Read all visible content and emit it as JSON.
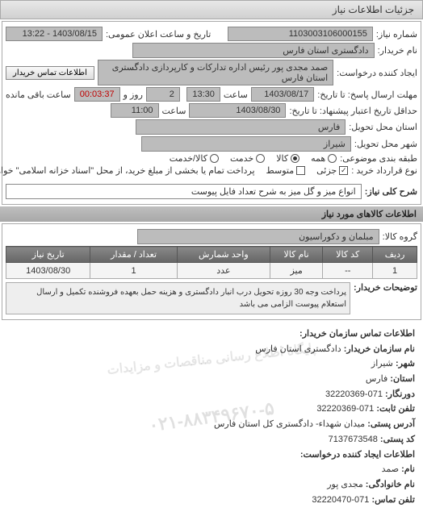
{
  "tab_title": "جزئیات اطلاعات نیاز",
  "header": {
    "req_no_label": "شماره نیاز:",
    "req_no": "1103003106000155",
    "announce_label": "تاریخ و ساعت اعلان عمومی:",
    "announce_val": "1403/08/15 - 13:22",
    "buyer_name_label": "نام خریدار:",
    "buyer_name": "دادگستری استان فارس",
    "creator_label": "ایجاد کننده درخواست:",
    "creator": "صمد مجدی پور رئیس اداره تدارکات و کارپردازی دادگستری استان فارس",
    "contact_btn": "اطلاعات تماس خریدار",
    "deadline_reply_label": "مهلت ارسال پاسخ: تا تاریخ:",
    "deadline_reply_date": "1403/08/17",
    "time_label": "ساعت",
    "deadline_reply_time": "13:30",
    "days_left": "2",
    "days_left_label": "روز و",
    "time_left": "00:03:37",
    "time_left_label": "ساعت باقی مانده",
    "credit_minfrom_label": "حداقل تاریخ اعتبار پیشنهاد: تا تاریخ:",
    "credit_date": "1403/08/30",
    "credit_time": "11:00",
    "province_label": "استان محل تحویل:",
    "province": "فارس",
    "city_label": "شهر محل تحویل:",
    "city": "شیراز",
    "category_label": "طبقه بندی موضوعی:",
    "radio_all": "همه",
    "radio_goods": "کالا",
    "radio_service": "خدمت",
    "radio_goods_service": "کالا/خدمت",
    "contract_type_label": "نوع قرارداد خرید :",
    "opt_small": "جزئی",
    "opt_medium": "متوسط",
    "contract_note": "پرداخت تمام یا بخشی از مبلغ خرید، از محل \"اسناد خزانه اسلامی\" خواهد بود.",
    "need_desc_label": "شرح کلی نیاز:",
    "need_desc": "انواع میز و گل میز به شرح تعداد فایل پیوست"
  },
  "section2_title": "اطلاعات کالاهای مورد نیاز",
  "goods_group_label": "گروه کالا:",
  "goods_group": "مبلمان و دکوراسیون",
  "table": {
    "cols": [
      "ردیف",
      "کد کالا",
      "نام کالا",
      "واحد شمارش",
      "تعداد / مقدار",
      "تاریخ نیاز"
    ],
    "row": [
      "1",
      "--",
      "میز",
      "عدد",
      "1",
      "1403/08/30"
    ]
  },
  "buyer_notes_label": "توضیحات خریدار:",
  "buyer_notes": "پرداخت وجه 30 روزه تحویل درب انبار دادگستری و هزینه حمل بعهده فروشنده تکمیل و ارسال استعلام پیوست الزامی می باشد",
  "contact_section": {
    "title": "اطلاعات تماس سازمان خریدار:",
    "org_label": "نام سازمان خریدار:",
    "org": "دادگستری استان فارس",
    "city_label": "شهر:",
    "city": "شیراز",
    "province_label": "استان:",
    "province": "فارس",
    "fax_label": "دورنگار:",
    "fax": "071-32220369",
    "phone_label": "تلفن ثابت:",
    "phone": "071-32220369",
    "address_label": "آدرس پستی:",
    "address": "میدان شهداء- دادگستری کل استان فارس",
    "postal_label": "کد پستی:",
    "postal": "7137673548",
    "creator_title": "اطلاعات ایجاد کننده درخواست:",
    "name_label": "نام:",
    "name": "صمد",
    "family_label": "نام خانوادگی:",
    "family": "مجدی پور",
    "phone2_label": "تلفن تماس:",
    "phone2": "071-32220470"
  },
  "watermark1": "پایگاه اطلاع رسانی مناقصات و مزایدات",
  "watermark2": "۰۲۱-۸۸۳۴۹۶۷۰-۵"
}
